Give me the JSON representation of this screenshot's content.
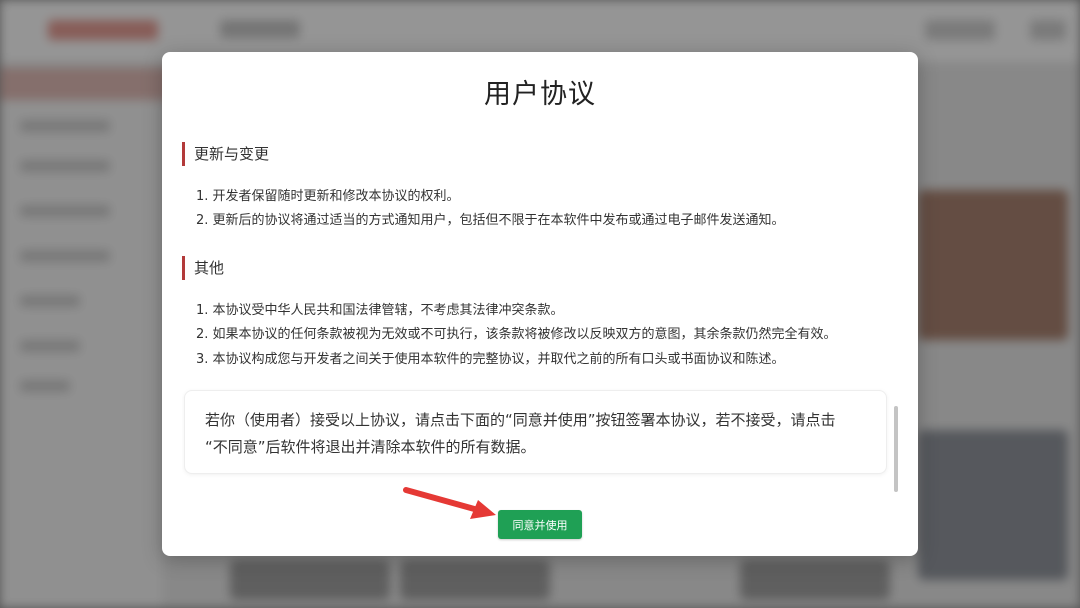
{
  "modal": {
    "title": "用户协议",
    "sections": [
      {
        "heading": "更新与变更",
        "items": [
          "1. 开发者保留随时更新和修改本协议的权利。",
          "2. 更新后的协议将通过适当的方式通知用户，包括但不限于在本软件中发布或通过电子邮件发送通知。"
        ]
      },
      {
        "heading": "其他",
        "items": [
          "1. 本协议受中华人民共和国法律管辖，不考虑其法律冲突条款。",
          "2. 如果本协议的任何条款被视为无效或不可执行，该条款将被修改以反映双方的意图，其余条款仍然完全有效。",
          "3. 本协议构成您与开发者之间关于使用本软件的完整协议，并取代之前的所有口头或书面协议和陈述。"
        ]
      }
    ],
    "notice": {
      "line1": "若你（使用者）接受以上协议，请点击下面的“同意并使用”按钮签署本协议，若不接受，请点击",
      "line2": "“不同意”后软件将退出并清除本软件的所有数据。"
    },
    "agree_button_label": "同意并使用"
  },
  "colors": {
    "accent_red": "#b33a3a",
    "button_green": "#1fa055",
    "annotation_arrow": "#e53935"
  },
  "icons": {
    "annotation": "red-arrow-icon"
  }
}
